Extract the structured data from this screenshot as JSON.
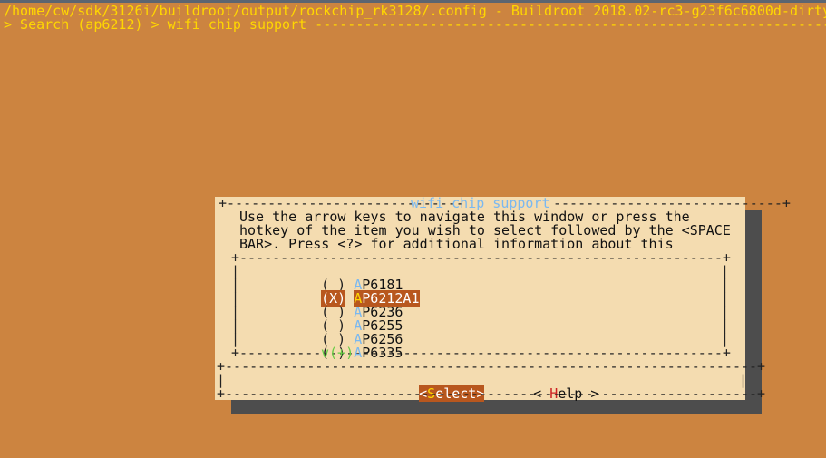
{
  "title_line": "/home/cw/sdk/3126i/buildroot/output/rockchip_rk3128/.config - Buildroot 2018.02-rc3-g23f6c6800d-dirty",
  "breadcrumb_line": "> Search (ap6212) > wifi chip support ---------------------------------------------------------------",
  "dialog": {
    "title": "wifi chip support",
    "help_lines": [
      "Use the arrow keys to navigate this window or press the",
      "hotkey of the item you wish to select followed by the <SPACE",
      "BAR>. Press <?> for additional information about this"
    ],
    "options": [
      {
        "check": "( )",
        "hotkey": "A",
        "rest": "P6181",
        "selected": false
      },
      {
        "check": "(X)",
        "hotkey": "A",
        "rest": "P6212A1",
        "selected": true
      },
      {
        "check": "( )",
        "hotkey": "A",
        "rest": "P6236",
        "selected": false
      },
      {
        "check": "( )",
        "hotkey": "A",
        "rest": "P6255",
        "selected": false
      },
      {
        "check": "( )",
        "hotkey": "A",
        "rest": "P6256",
        "selected": false
      },
      {
        "check": "( )",
        "hotkey": "A",
        "rest": "P6335",
        "selected": false
      }
    ],
    "more_indicator": "v(+)",
    "buttons": {
      "select": {
        "open": "<",
        "hotkey": "S",
        "rest": "elect",
        "close": ">"
      },
      "help": {
        "open": "< ",
        "hotkey": "H",
        "rest": "elp",
        "close": " >"
      }
    }
  },
  "colors": {
    "background": "#cc8440",
    "dialog_bg": "#f4dcb0",
    "highlight": "#b8571e",
    "title_text": "#ffd700",
    "hotkey": "#7ab8f0",
    "more_indicator": "#66cc44"
  }
}
